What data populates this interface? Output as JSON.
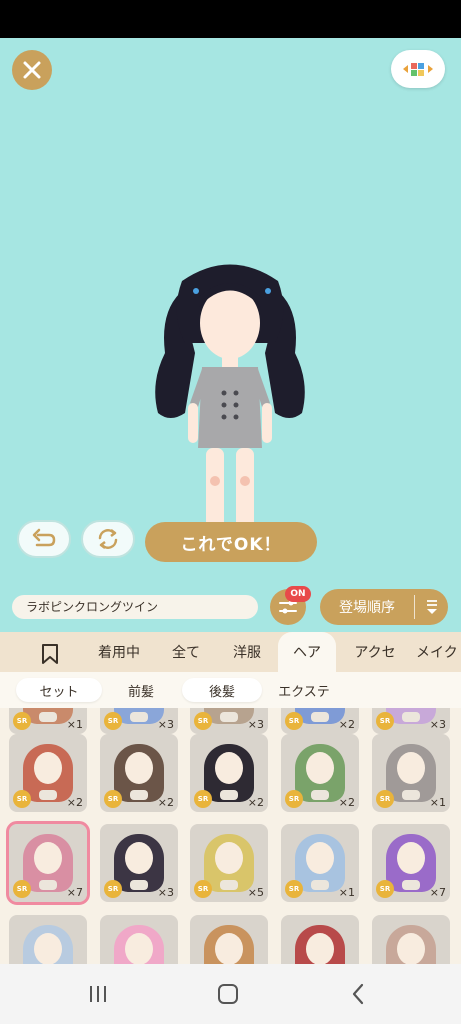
{
  "outfit_name": "ラボピンクロングツイン",
  "ok_label": "これでOK！",
  "filter_badge": "ON",
  "sort_label": "登場順序",
  "tabs": [
    "着用中",
    "全て",
    "洋服",
    "ヘア",
    "アクセ",
    "メイク"
  ],
  "active_tab": "ヘア",
  "subtabs": [
    "セット",
    "前髪",
    "後髪",
    "エクステ"
  ],
  "active_subtab": "後髪",
  "items": [
    {
      "rarity": "SR",
      "count": "×1",
      "hair": "#c98a6b"
    },
    {
      "rarity": "SR",
      "count": "×3",
      "hair": "#8aa6d9"
    },
    {
      "rarity": "SR",
      "count": "×3",
      "hair": "#b7a38f"
    },
    {
      "rarity": "SR",
      "count": "×2",
      "hair": "#7f9bd6"
    },
    {
      "rarity": "SR",
      "count": "×3",
      "hair": "#c8a9d9"
    },
    {
      "rarity": "SR",
      "count": "×2",
      "hair": "#c86a55"
    },
    {
      "rarity": "SR",
      "count": "×2",
      "hair": "#6b5548"
    },
    {
      "rarity": "SR",
      "count": "×2",
      "hair": "#2e2a33"
    },
    {
      "rarity": "SR",
      "count": "×2",
      "hair": "#7aa36a"
    },
    {
      "rarity": "SR",
      "count": "×1",
      "hair": "#a09a98"
    },
    {
      "rarity": "SR",
      "count": "×7",
      "hair": "#d98fa3"
    },
    {
      "rarity": "SR",
      "count": "×3",
      "hair": "#3c3544"
    },
    {
      "rarity": "SR",
      "count": "×5",
      "hair": "#d9c56a"
    },
    {
      "rarity": "SR",
      "count": "×1",
      "hair": "#a8c3e0"
    },
    {
      "rarity": "SR",
      "count": "×7",
      "hair": "#9a6bc9"
    },
    {
      "rarity": "",
      "count": "",
      "hair": "#b8cbe0"
    },
    {
      "rarity": "",
      "count": "",
      "hair": "#f0a8c8"
    },
    {
      "rarity": "",
      "count": "",
      "hair": "#c9935e"
    },
    {
      "rarity": "",
      "count": "",
      "hair": "#b84a4a"
    },
    {
      "rarity": "",
      "count": "",
      "hair": "#c8a89a"
    }
  ],
  "colors": {
    "accent": "#c9a15c",
    "stage_bg": "#a6e6e2",
    "badge_red": "#e84a4a",
    "sr_gold": "#e9b43b",
    "selected_outline": "#f08aa0"
  }
}
